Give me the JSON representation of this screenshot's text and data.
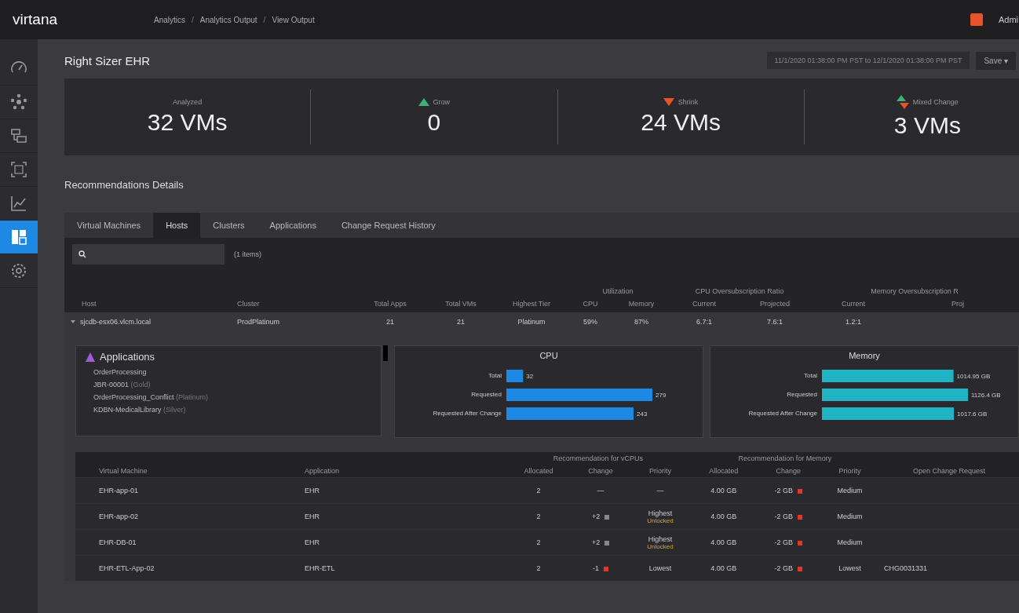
{
  "topbar": {
    "logo": "virtana",
    "breadcrumbs": [
      "Analytics",
      "Analytics Output",
      "View Output"
    ],
    "separators": [
      "/",
      "/"
    ],
    "user": "Admi"
  },
  "sidebar": {
    "items": [
      {
        "selected": false
      },
      {
        "selected": false
      },
      {
        "selected": false
      },
      {
        "selected": false
      },
      {
        "selected": false
      },
      {
        "selected": true
      },
      {
        "selected": false
      }
    ]
  },
  "page": {
    "title": "Right Sizer EHR",
    "date_range": "11/1/2020 01:38:00 PM PST to 12/1/2020 01:38:00 PM PST",
    "save_button": "Save ▾"
  },
  "summary": [
    {
      "label": "Analyzed",
      "value": "32 VMs",
      "kind": "none"
    },
    {
      "label": "Grow",
      "value": "0",
      "kind": "up"
    },
    {
      "label": "Shrink",
      "value": "24 VMs",
      "kind": "down"
    },
    {
      "label": "Mixed Change",
      "value": "3 VMs",
      "kind": "mixed"
    }
  ],
  "section_title": "Recommendations Details",
  "tabs": [
    {
      "label": "Virtual Machines",
      "selected": false
    },
    {
      "label": "Hosts",
      "selected": true
    },
    {
      "label": "Clusters",
      "selected": false
    },
    {
      "label": "Applications",
      "selected": false
    },
    {
      "label": "Change Request History",
      "selected": false
    }
  ],
  "item_count": "(1 items)",
  "host_table": {
    "groups": [
      "Utilization",
      "CPU Oversubscription Ratio",
      "Memory Oversubscription R"
    ],
    "columns": [
      "Host",
      "Cluster",
      "Total Apps",
      "Total VMs",
      "Highest Tier",
      "CPU",
      "Memory",
      "Current",
      "Projected",
      "Current",
      "Proj"
    ],
    "rows": [
      {
        "expanded": true,
        "cells": [
          "sjcdb-esx06.vlcm.local",
          "ProdPlatinum",
          "21",
          "21",
          "Platinum",
          "59%",
          "87%",
          "6.7:1",
          "7.6:1",
          "1.2:1"
        ]
      }
    ]
  },
  "applications": {
    "title": "Applications",
    "items": [
      {
        "name": "OrderProcessing"
      },
      {
        "name": "JBR-00001",
        "tier": "(Gold)"
      },
      {
        "name": "OrderProcessing_Conflict",
        "tier": "(Platinum)"
      },
      {
        "name": "KDBN-MedicalLibrary",
        "tier": "(Silver)"
      }
    ]
  },
  "cpu_panel": {
    "chart_data": {
      "type": "bar",
      "title": "CPU",
      "orientation": "horizontal",
      "categories": [
        "Total",
        "Requested",
        "Requested After Change"
      ],
      "series": [
        {
          "color": "#1e88e5",
          "values": [
            32,
            279,
            243
          ]
        }
      ],
      "data_labels": true
    }
  },
  "memory_panel": {
    "units": [
      "GB",
      "GB",
      "GB"
    ],
    "chart_data": {
      "type": "bar",
      "title": "Memory",
      "orientation": "horizontal",
      "categories": [
        "Total",
        "Requested",
        "Requested After Change"
      ],
      "series": [
        {
          "color": "#1fb3c4",
          "values": [
            1014.95,
            1126.4,
            1017.6
          ]
        }
      ],
      "data_labels": true
    }
  },
  "vm_table": {
    "groups": [
      "Recommendation for vCPUs",
      "Recommendation for Memory"
    ],
    "columns": [
      "Virtual Machine",
      "Application",
      "Allocated",
      "Change",
      "Priority",
      "Allocated",
      "Change",
      "Priority",
      "Open Change Request"
    ],
    "rows": [
      {
        "vm": "EHR-app-01",
        "app": "EHR",
        "cpu_alloc": "2",
        "cpu_change": {
          "text": "—",
          "kind": "none"
        },
        "cpu_priority": "—",
        "mem_alloc": "4.00 GB",
        "mem_change": {
          "text": "-2 GB",
          "kind": "down"
        },
        "mem_priority": "Medium"
      },
      {
        "vm": "EHR-app-02",
        "app": "EHR",
        "cpu_alloc": "2",
        "cpu_change": {
          "text": "+2",
          "kind": "up"
        },
        "cpu_priority": "Highest",
        "cpu_priority_note": "Unlocked",
        "mem_alloc": "4.00 GB",
        "mem_change": {
          "text": "-2 GB",
          "kind": "down"
        },
        "mem_priority": "Medium"
      },
      {
        "vm": "EHR-DB-01",
        "app": "EHR",
        "cpu_alloc": "2",
        "cpu_change": {
          "text": "+2",
          "kind": "up"
        },
        "cpu_priority": "Highest",
        "cpu_priority_note": "Unlocked",
        "mem_alloc": "4.00 GB",
        "mem_change": {
          "text": "-2 GB",
          "kind": "down"
        },
        "mem_priority": "Medium"
      },
      {
        "vm": "EHR-ETL-App-02",
        "app": "EHR-ETL",
        "cpu_alloc": "2",
        "cpu_change": {
          "text": "-1",
          "kind": "down"
        },
        "cpu_priority": "Lowest",
        "mem_alloc": "4.00 GB",
        "mem_change": {
          "text": "-2 GB",
          "kind": "down"
        },
        "mem_priority": "Lowest",
        "request": "CHG0031331"
      }
    ]
  }
}
